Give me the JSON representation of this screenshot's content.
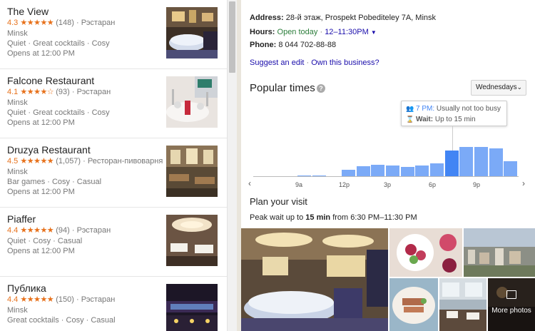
{
  "results": [
    {
      "name": "The View",
      "rating": "4.3",
      "stars": "★★★★★",
      "reviews": "(148)",
      "type": "Рэстаран",
      "city": "Minsk",
      "features": "Quiet · Great cocktails · Cosy",
      "hours": "Opens at 12:00 PM"
    },
    {
      "name": "Falcone Restaurant",
      "rating": "4.1",
      "stars": "★★★★☆",
      "reviews": "(93)",
      "type": "Рэстаран",
      "city": "Minsk",
      "features": "Quiet · Great cocktails · Cosy",
      "hours": "Opens at 12:00 PM"
    },
    {
      "name": "Druzya Restaurant",
      "rating": "4.5",
      "stars": "★★★★★",
      "reviews": "(1,057)",
      "type": "Ресторан-пивоварня",
      "city": "Minsk",
      "features": "Bar games · Cosy · Casual",
      "hours": "Opens at 12:00 PM"
    },
    {
      "name": "Piaffer",
      "rating": "4.4",
      "stars": "★★★★★",
      "reviews": "(94)",
      "type": "Рэстаран",
      "city": "",
      "features": "Quiet · Cosy · Casual",
      "hours": "Opens at 12:00 PM"
    },
    {
      "name": "Публика",
      "rating": "4.4",
      "stars": "★★★★★",
      "reviews": "(150)",
      "type": "Рэстаран",
      "city": "Minsk",
      "features": "Great cocktails · Cosy · Casual",
      "hours": ""
    }
  ],
  "details": {
    "address_label": "Address:",
    "address": "28-й этаж, Prospekt Pobediteley 7A, Minsk",
    "hours_label": "Hours:",
    "hours_status": "Open today",
    "hours_time": "12–11:30PM",
    "phone_label": "Phone:",
    "phone": "8 044 702-88-88",
    "suggest_edit": "Suggest an edit",
    "separator": " · ",
    "own_business": "Own this business?"
  },
  "popular_times": {
    "title": "Popular times",
    "day": "Wednesdays",
    "tooltip_time": "7 PM:",
    "tooltip_status": "Usually not too busy",
    "tooltip_wait_label": "Wait:",
    "tooltip_wait": "Up to 15 min",
    "ticks": [
      "9a",
      "12p",
      "3p",
      "6p",
      "9p"
    ]
  },
  "chart_data": {
    "type": "bar",
    "title": "Popular times",
    "categories": [
      "6a",
      "7a",
      "8a",
      "9a",
      "10a",
      "11a",
      "12p",
      "1p",
      "2p",
      "3p",
      "4p",
      "5p",
      "6p",
      "7p",
      "8p",
      "9p",
      "10p",
      "11p"
    ],
    "values": [
      0,
      0,
      0,
      2,
      2,
      0,
      18,
      26,
      30,
      28,
      25,
      28,
      34,
      68,
      78,
      78,
      75,
      40
    ],
    "highlight": "7p",
    "ylim": [
      0,
      100
    ],
    "colors": {
      "bar": "#7baaf7",
      "current": "#4285f4"
    }
  },
  "plan": {
    "title": "Plan your visit",
    "peak_prefix": "Peak wait up to ",
    "peak_value": "15 min",
    "peak_suffix": " from 6:30 PM–11:30 PM"
  },
  "photos": {
    "more_label": "More photos"
  }
}
